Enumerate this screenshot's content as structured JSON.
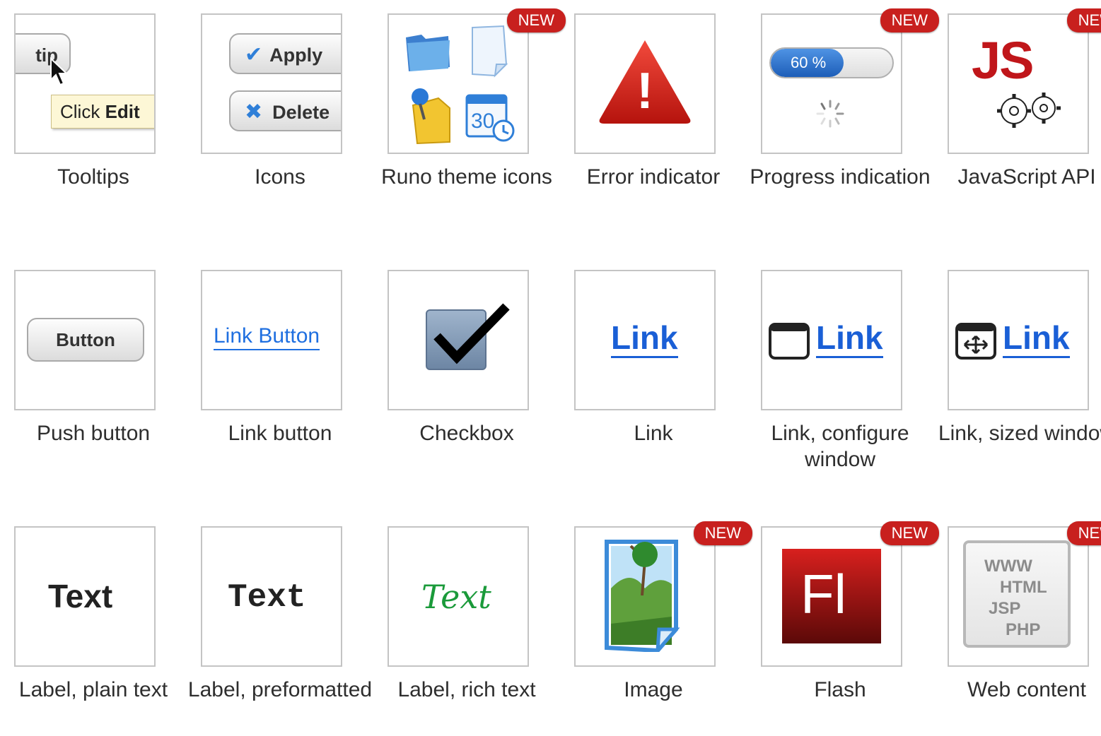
{
  "tiles": [
    {
      "caption": "Tooltips",
      "thumb": {
        "button_text": "tip",
        "tooltip_prefix": "Click",
        "tooltip_bold": "Edit"
      }
    },
    {
      "caption": "Icons",
      "thumb": {
        "apply_label": "Apply",
        "delete_label": "Delete"
      }
    },
    {
      "caption": "Runo theme icons",
      "badge": "NEW",
      "thumb": {
        "calendar_day": "30"
      }
    },
    {
      "caption": "Error indicator",
      "thumb": {
        "mark": "!"
      }
    },
    {
      "caption": "Progress indication",
      "badge": "NEW",
      "thumb": {
        "progress_text": "60 %",
        "progress_value": 0.6
      }
    },
    {
      "caption": "JavaScript API",
      "badge": "NEW",
      "thumb": {
        "logo_text": "JS"
      }
    },
    {
      "caption": "Push button",
      "thumb": {
        "button_label": "Button"
      }
    },
    {
      "caption": "Link button",
      "thumb": {
        "link_label": "Link Button"
      }
    },
    {
      "caption": "Checkbox",
      "thumb": {}
    },
    {
      "caption": "Link",
      "thumb": {
        "link_label": "Link"
      }
    },
    {
      "caption": "Link, configure window",
      "thumb": {
        "link_label": "Link"
      }
    },
    {
      "caption": "Link, sized window",
      "thumb": {
        "link_label": "Link"
      }
    },
    {
      "caption": "Label, plain text",
      "thumb": {
        "text": "Text"
      }
    },
    {
      "caption": "Label, preformatted",
      "thumb": {
        "text": "Text"
      }
    },
    {
      "caption": "Label, rich text",
      "thumb": {
        "text": "Text"
      }
    },
    {
      "caption": "Image",
      "badge": "NEW",
      "thumb": {}
    },
    {
      "caption": "Flash",
      "badge": "NEW",
      "thumb": {
        "logo_text": "Fl"
      }
    },
    {
      "caption": "Web content",
      "badge": "NEW",
      "thumb": {
        "lines": [
          "WWW",
          "HTML",
          "JSP",
          "PHP"
        ]
      }
    }
  ],
  "colors": {
    "badge": "#c8201e",
    "link": "#1a5fd6",
    "border": "#c4c4c4"
  }
}
